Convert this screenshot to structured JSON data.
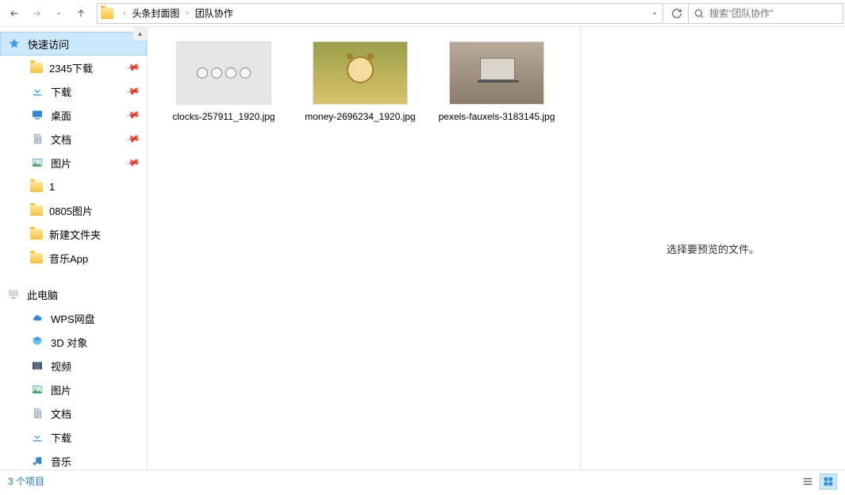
{
  "breadcrumb": {
    "folder1": "头条封面图",
    "folder2": "团队协作"
  },
  "search": {
    "placeholder": "搜索\"团队协作\""
  },
  "sidebar": {
    "quick_access": "快速访问",
    "items": [
      {
        "label": "2345下载",
        "pinned": true,
        "icon": "folder"
      },
      {
        "label": "下载",
        "pinned": true,
        "icon": "download"
      },
      {
        "label": "桌面",
        "pinned": true,
        "icon": "desktop"
      },
      {
        "label": "文档",
        "pinned": true,
        "icon": "document"
      },
      {
        "label": "图片",
        "pinned": true,
        "icon": "picture"
      },
      {
        "label": "1",
        "pinned": false,
        "icon": "folder"
      },
      {
        "label": "0805图片",
        "pinned": false,
        "icon": "folder"
      },
      {
        "label": "新建文件夹",
        "pinned": false,
        "icon": "folder"
      },
      {
        "label": "音乐App",
        "pinned": false,
        "icon": "folder"
      }
    ],
    "this_pc": "此电脑",
    "pc_items": [
      {
        "label": "WPS网盘",
        "icon": "cloud"
      },
      {
        "label": "3D 对象",
        "icon": "3d"
      },
      {
        "label": "视频",
        "icon": "video"
      },
      {
        "label": "图片",
        "icon": "picture"
      },
      {
        "label": "文档",
        "icon": "document"
      },
      {
        "label": "下载",
        "icon": "download"
      },
      {
        "label": "音乐",
        "icon": "music"
      }
    ]
  },
  "files": [
    {
      "name": "clocks-257911_1920.jpg",
      "thumb": "clocks"
    },
    {
      "name": "money-2696234_1920.jpg",
      "thumb": "money"
    },
    {
      "name": "pexels-fauxels-3183145.jpg",
      "thumb": "pexels"
    }
  ],
  "preview": {
    "empty_text": "选择要预览的文件。"
  },
  "status": {
    "count": "3 个项目"
  }
}
